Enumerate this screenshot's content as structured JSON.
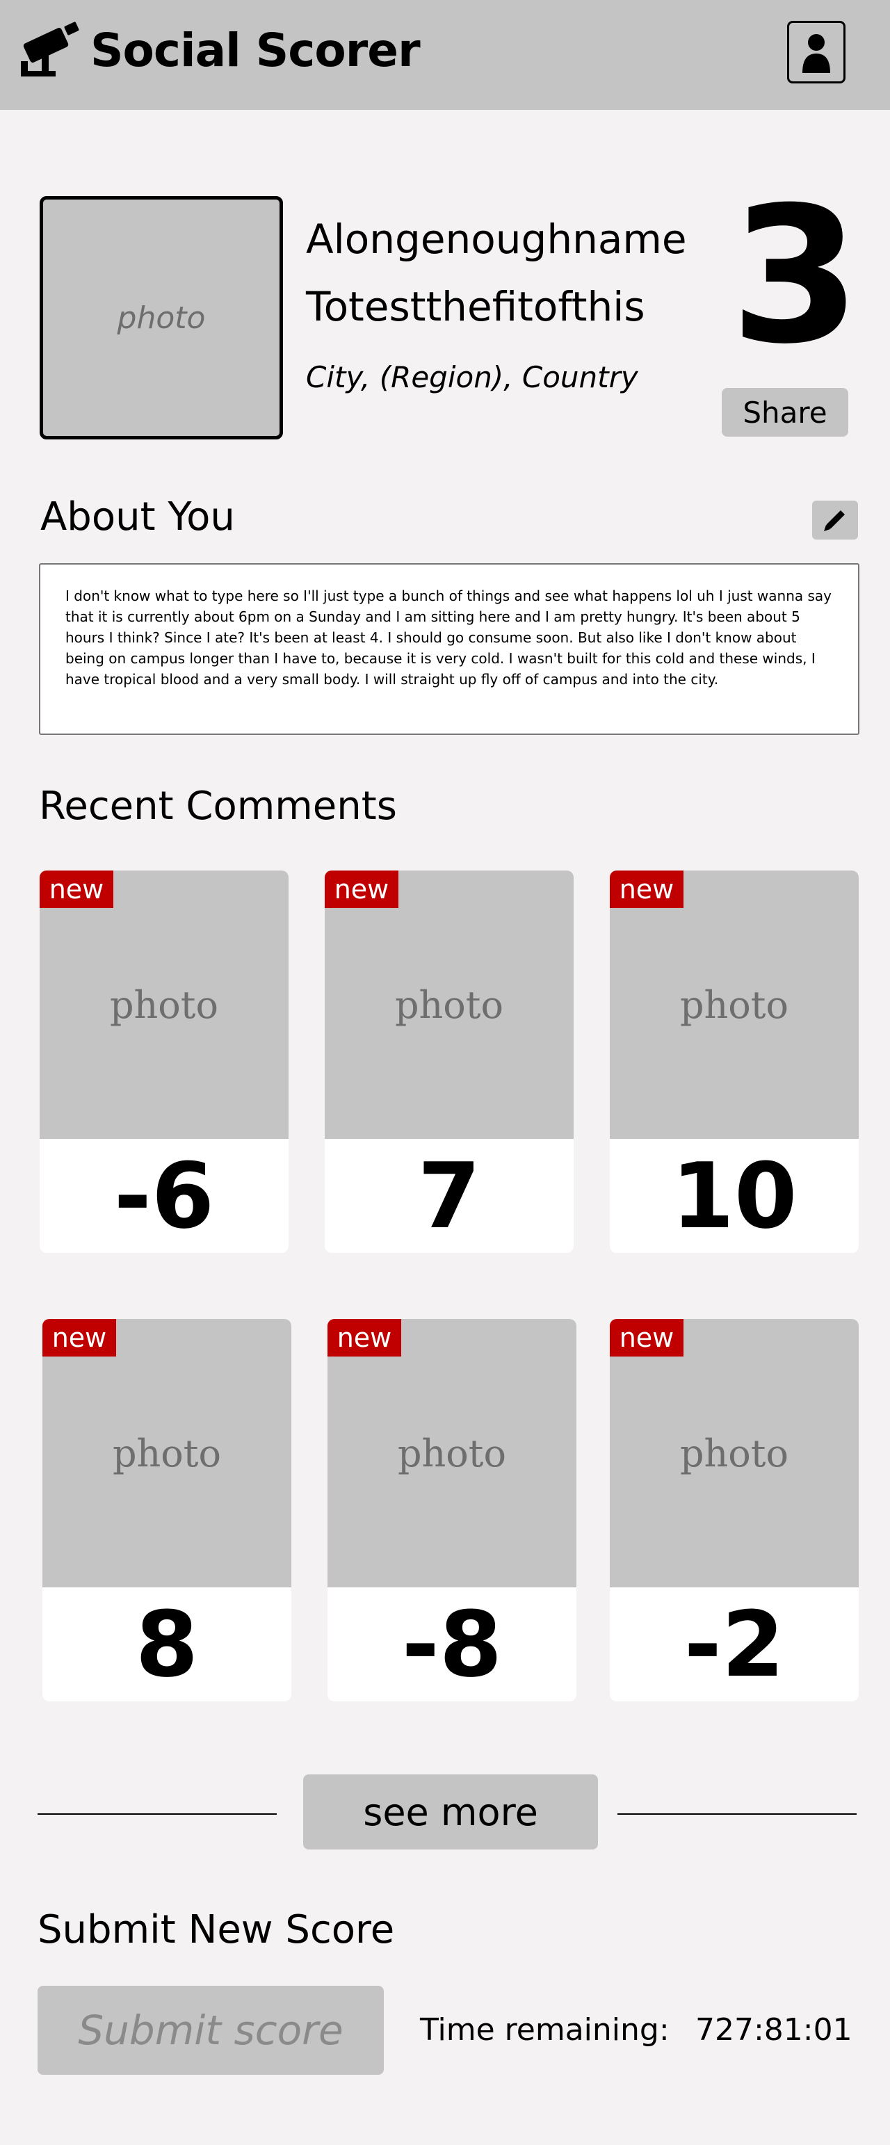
{
  "header": {
    "app_title": "Social Scorer",
    "logo_icon": "security-camera-icon",
    "profile_icon": "user-silhouette-icon"
  },
  "profile": {
    "photo_placeholder": "photo",
    "first_name": "Alongenoughname",
    "last_name": "Totestthefitofthis",
    "location": "City, (Region), Country",
    "score": "3",
    "share_label": "Share"
  },
  "about": {
    "title": "About You",
    "edit_icon": "pencil-icon",
    "text": "I don't know what to type here so I'll just type a bunch of things and see what happens lol uh I just wanna say that it is currently about 6pm on a Sunday and I am sitting here and I am pretty hungry. It's been about 5 hours I think? Since I ate? It's been at least 4. I should go consume soon. But also like I don't know about being on campus longer than I have to, because it is very cold. I wasn't built for this cold and these winds, I have tropical blood and a very small body. I will straight up fly off of campus and into the city."
  },
  "comments": {
    "title": "Recent Comments",
    "items": [
      {
        "badge": "new",
        "photo": "photo",
        "score": "-6"
      },
      {
        "badge": "new",
        "photo": "photo",
        "score": "7"
      },
      {
        "badge": "new",
        "photo": "photo",
        "score": "10"
      },
      {
        "badge": "new",
        "photo": "photo",
        "score": "8"
      },
      {
        "badge": "new",
        "photo": "photo",
        "score": "-8"
      },
      {
        "badge": "new",
        "photo": "photo",
        "score": "-2"
      }
    ],
    "see_more_label": "see more"
  },
  "submit": {
    "title": "Submit New Score",
    "button_label": "Submit score",
    "time_label": "Time remaining:",
    "time_value": "727:81:01"
  },
  "colors": {
    "header_bg": "#c4c4c4",
    "page_bg": "#f4f2f3",
    "badge_red": "#c00000"
  }
}
